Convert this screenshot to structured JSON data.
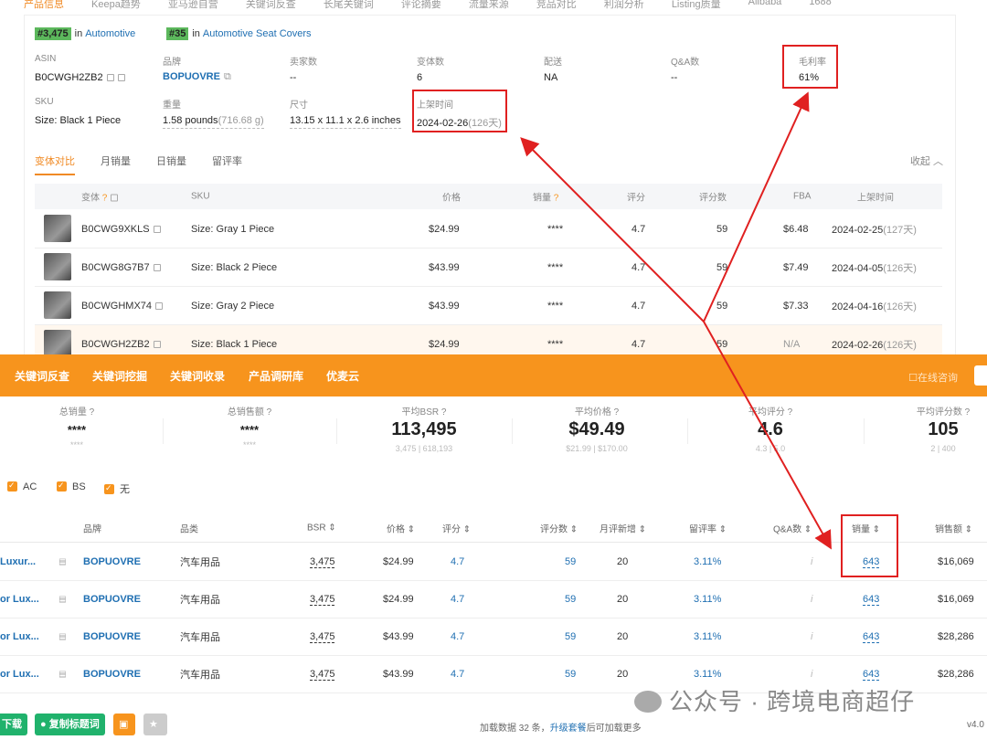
{
  "top_tabs": [
    "产品信息",
    "Keepa趋势",
    "亚马逊自营",
    "关键词反查",
    "长尾关键词",
    "评论摘要",
    "流量来源",
    "竞品对比",
    "利润分析",
    "Listing质量",
    "Alibaba",
    "1688"
  ],
  "ranks": [
    {
      "badge": "#3,475",
      "in": "in",
      "category": "Automotive"
    },
    {
      "badge": "#35",
      "in": "in",
      "category": "Automotive Seat Covers"
    }
  ],
  "fields_row1": [
    {
      "label": "ASIN",
      "value": "B0CWGH2ZB2"
    },
    {
      "label": "品牌",
      "value": "BOPUOVRE"
    },
    {
      "label": "卖家数",
      "value": "--"
    },
    {
      "label": "变体数",
      "value": "6"
    },
    {
      "label": "配送",
      "value": "NA"
    },
    {
      "label": "Q&A数",
      "value": "--"
    },
    {
      "label": "毛利率",
      "value": "61%"
    }
  ],
  "fields_row2": [
    {
      "label": "SKU",
      "value": "Size: Black 1 Piece"
    },
    {
      "label": "重量",
      "value": "1.58 pounds",
      "extra": "(716.68 g)"
    },
    {
      "label": "尺寸",
      "value": "13.15 x 11.1 x 2.6 inches"
    },
    {
      "label": "上架时间",
      "value": "2024-02-26",
      "extra": "(126天)"
    }
  ],
  "subtabs": [
    "变体对比",
    "月销量",
    "日销量",
    "留评率"
  ],
  "collapse_label": "收起",
  "variant_headers": [
    "变体",
    "SKU",
    "价格",
    "销量",
    "评分",
    "评分数",
    "FBA",
    "上架时间"
  ],
  "variants": [
    {
      "asin": "B0CWG9XKLS",
      "sku": "Size: Gray 1 Piece",
      "price": "$24.99",
      "sales": "****",
      "rating": "4.7",
      "reviews": "59",
      "fba": "$6.48",
      "date": "2024-02-25",
      "days": "(127天)"
    },
    {
      "asin": "B0CWG8G7B7",
      "sku": "Size: Black 2 Piece",
      "price": "$43.99",
      "sales": "****",
      "rating": "4.7",
      "reviews": "59",
      "fba": "$7.49",
      "date": "2024-04-05",
      "days": "(126天)"
    },
    {
      "asin": "B0CWGHMX74",
      "sku": "Size: Gray 2 Piece",
      "price": "$43.99",
      "sales": "****",
      "rating": "4.7",
      "reviews": "59",
      "fba": "$7.33",
      "date": "2024-04-16",
      "days": "(126天)"
    },
    {
      "asin": "B0CWGH2ZB2",
      "sku": "Size: Black 1 Piece",
      "price": "$24.99",
      "sales": "****",
      "rating": "4.7",
      "reviews": "59",
      "fba": "N/A",
      "date": "2024-02-26",
      "days": "(126天)"
    }
  ],
  "orange_menu": [
    "关键词反查",
    "关键词挖掘",
    "关键词收录",
    "产品调研库",
    "优麦云"
  ],
  "consult_label": "在线咨询",
  "stats": [
    {
      "title": "总销量",
      "value": "****",
      "range": "****"
    },
    {
      "title": "总销售额",
      "value": "****",
      "range": "****"
    },
    {
      "title": "平均BSR",
      "value": "113,495",
      "range": "3,475 | 618,193"
    },
    {
      "title": "平均价格",
      "value": "$49.49",
      "range": "$21.99 | $170.00"
    },
    {
      "title": "平均评分",
      "value": "4.6",
      "range": "4.3 | 5.0"
    },
    {
      "title": "平均评分数",
      "value": "105",
      "range": "2 | 400"
    }
  ],
  "filters": [
    "AC",
    "BS",
    "无"
  ],
  "main_headers": [
    "品牌",
    "品类",
    "BSR",
    "价格",
    "评分",
    "评分数",
    "月评新增",
    "留评率",
    "Q&A数",
    "销量",
    "销售额"
  ],
  "main_rows": [
    {
      "title": "Luxur...",
      "brand": "BOPUOVRE",
      "category": "汽车用品",
      "bsr": "3,475",
      "price": "$24.99",
      "rating": "4.7",
      "reviews": "59",
      "monthly": "20",
      "rate": "3.11%",
      "qa": "i",
      "sales": "643",
      "revenue": "$16,069"
    },
    {
      "title": "or Lux...",
      "brand": "BOPUOVRE",
      "category": "汽车用品",
      "bsr": "3,475",
      "price": "$24.99",
      "rating": "4.7",
      "reviews": "59",
      "monthly": "20",
      "rate": "3.11%",
      "qa": "i",
      "sales": "643",
      "revenue": "$16,069"
    },
    {
      "title": "or Lux...",
      "brand": "BOPUOVRE",
      "category": "汽车用品",
      "bsr": "3,475",
      "price": "$43.99",
      "rating": "4.7",
      "reviews": "59",
      "monthly": "20",
      "rate": "3.11%",
      "qa": "i",
      "sales": "643",
      "revenue": "$28,286"
    },
    {
      "title": "or Lux...",
      "brand": "BOPUOVRE",
      "category": "汽车用品",
      "bsr": "3,475",
      "price": "$43.99",
      "rating": "4.7",
      "reviews": "59",
      "monthly": "20",
      "rate": "3.11%",
      "qa": "i",
      "sales": "643",
      "revenue": "$28,286"
    }
  ],
  "bottom": {
    "download": "下载",
    "copy_titles": "复制标题词",
    "load_info_prefix": "加载数据 32 条，",
    "upgrade_link": "升级套餐",
    "load_info_suffix": "后可加载更多",
    "version": "v4.0"
  },
  "watermark": "公众号 · 跨境电商超仔",
  "colors": {
    "orange": "#f7941d",
    "link_blue": "#1f6fb2",
    "annotation_red": "#e02020",
    "rank_green": "#5cb85c"
  }
}
